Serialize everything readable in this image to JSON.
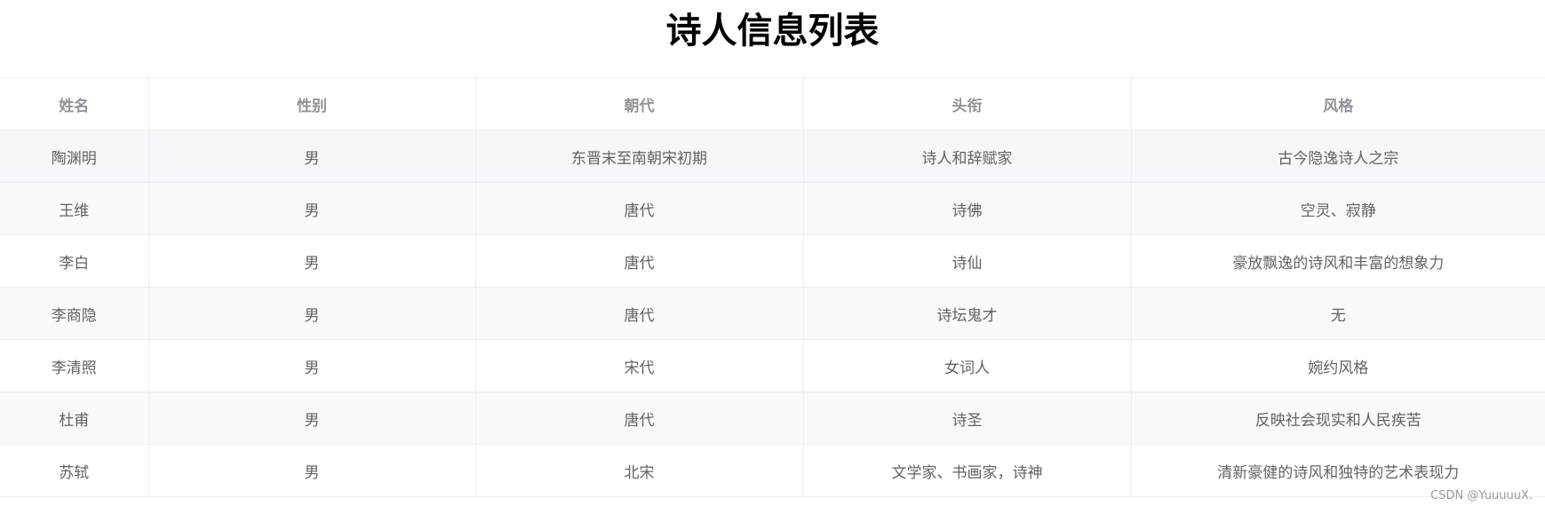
{
  "page": {
    "title": "诗人信息列表"
  },
  "table": {
    "columns": [
      "姓名",
      "性别",
      "朝代",
      "头衔",
      "风格"
    ],
    "rows": [
      [
        "陶渊明",
        "男",
        "东晋末至南朝宋初期",
        "诗人和辞赋家",
        "古今隐逸诗人之宗"
      ],
      [
        "王维",
        "男",
        "唐代",
        "诗佛",
        "空灵、寂静"
      ],
      [
        "李白",
        "男",
        "唐代",
        "诗仙",
        "豪放飘逸的诗风和丰富的想象力"
      ],
      [
        "李商隐",
        "男",
        "唐代",
        "诗坛鬼才",
        "无"
      ],
      [
        "李清照",
        "男",
        "宋代",
        "女词人",
        "婉约风格"
      ],
      [
        "杜甫",
        "男",
        "唐代",
        "诗圣",
        "反映社会现实和人民疾苦"
      ],
      [
        "苏轼",
        "男",
        "北宋",
        "文学家、书画家，诗神",
        "清新豪健的诗风和独特的艺术表现力"
      ]
    ]
  },
  "watermark": "CSDN @YuuuuuX.",
  "colors": {
    "header_text": "#909399",
    "body_text": "#606266",
    "border": "#ebeef5",
    "stripe": "#fafafa",
    "hover": "#f5f7fa"
  }
}
